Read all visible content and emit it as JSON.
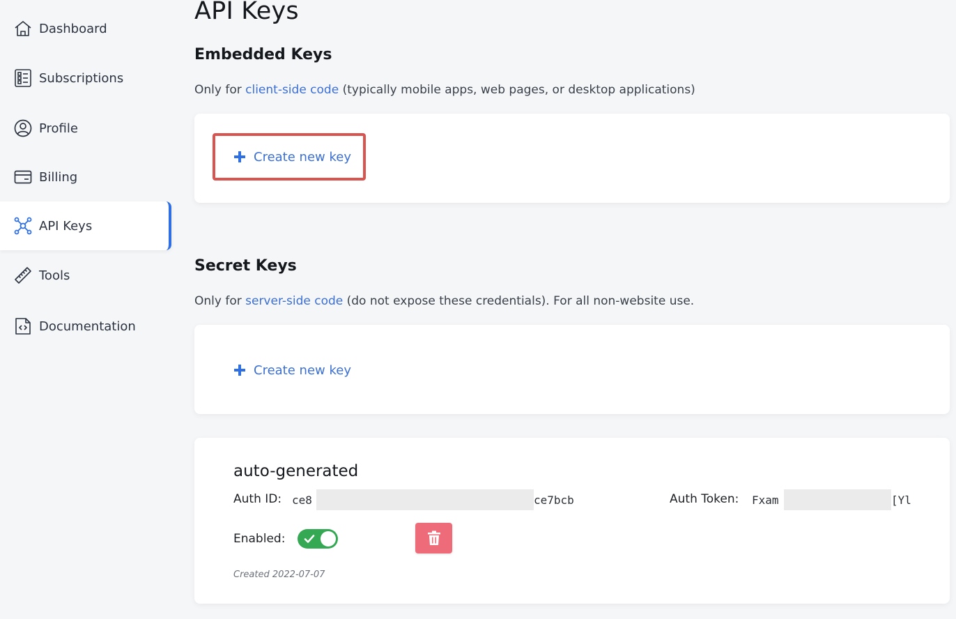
{
  "sidebar": {
    "items": [
      {
        "label": "Dashboard",
        "icon": "home-icon"
      },
      {
        "label": "Subscriptions",
        "icon": "list-icon"
      },
      {
        "label": "Profile",
        "icon": "user-circle-icon"
      },
      {
        "label": "Billing",
        "icon": "credit-card-icon"
      },
      {
        "label": "API Keys",
        "icon": "network-icon",
        "active": true
      },
      {
        "label": "Tools",
        "icon": "ruler-icon"
      },
      {
        "label": "Documentation",
        "icon": "code-file-icon"
      }
    ]
  },
  "main": {
    "title": "API Keys",
    "embedded": {
      "title": "Embedded Keys",
      "desc_prefix": "Only for ",
      "desc_link": "client-side code",
      "desc_suffix": " (typically mobile apps, web pages, or desktop applications)",
      "create_label": "Create new key"
    },
    "secret": {
      "title": "Secret Keys",
      "desc_prefix": "Only for ",
      "desc_link": "server-side code",
      "desc_suffix": " (do not expose these credentials). For all non-website use.",
      "create_label": "Create new key"
    },
    "key": {
      "name": "auto-generated",
      "auth_id_label": "Auth ID:",
      "auth_id_start": "ce8",
      "auth_id_end": "ce7bcb",
      "auth_token_label": "Auth Token:",
      "auth_token_start": "Fxam",
      "auth_token_end": "[Yl",
      "enabled_label": "Enabled:",
      "enabled": true,
      "created": "Created 2022-07-07"
    }
  },
  "colors": {
    "accent": "#2f6fe4",
    "link": "#3b6fd4",
    "highlight": "#d9534f",
    "toggle_on": "#34a853",
    "delete": "#ee6b7a"
  }
}
